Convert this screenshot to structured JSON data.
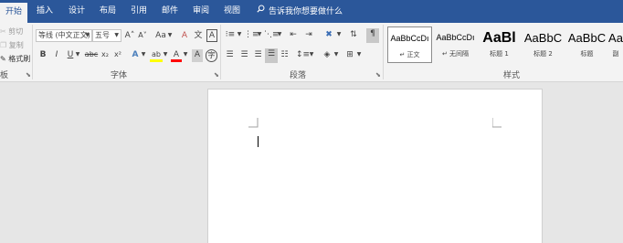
{
  "tabs": [
    {
      "label": "开始",
      "active": true
    },
    {
      "label": "插入"
    },
    {
      "label": "设计"
    },
    {
      "label": "布局"
    },
    {
      "label": "引用"
    },
    {
      "label": "邮件"
    },
    {
      "label": "审阅"
    },
    {
      "label": "视图"
    }
  ],
  "search": {
    "placeholder": "告诉我你想要做什么"
  },
  "clipboard": {
    "cut": "剪切",
    "copy": "复制",
    "format_painter": "格式刷",
    "group_label_fragment": "板"
  },
  "font": {
    "family": "等线 (中文正文)",
    "size": "五号",
    "grow_label": "A˄",
    "shrink_label": "A˅",
    "case_label": "Aa",
    "clear_label": "A",
    "phonetic_label": "文",
    "border_char_label": "A",
    "bold": "B",
    "italic": "I",
    "underline": "U",
    "strike": "abc",
    "subscript": "x₂",
    "superscript": "x²",
    "effects": "A",
    "highlight": "ab",
    "font_color": "A",
    "shade": "A",
    "enclose": "字",
    "group_label": "字体"
  },
  "paragraph": {
    "group_label": "段落"
  },
  "styles": {
    "group_label": "样式",
    "items": [
      {
        "sample": "AaBbCcDı",
        "name": "正文",
        "check": "↵",
        "selected": true
      },
      {
        "sample": "AaBbCcDı",
        "name": "无间隔",
        "check": "↵"
      },
      {
        "sample": "AaBl",
        "name": "标题 1"
      },
      {
        "sample": "AaBbC",
        "name": "标题 2"
      },
      {
        "sample": "AaBbC",
        "name": "标题"
      },
      {
        "sample": "Aa",
        "name": "副"
      }
    ]
  },
  "colors": {
    "accent": "#2b579a",
    "highlight": "#ffff00",
    "font_color": "#ff0000"
  }
}
